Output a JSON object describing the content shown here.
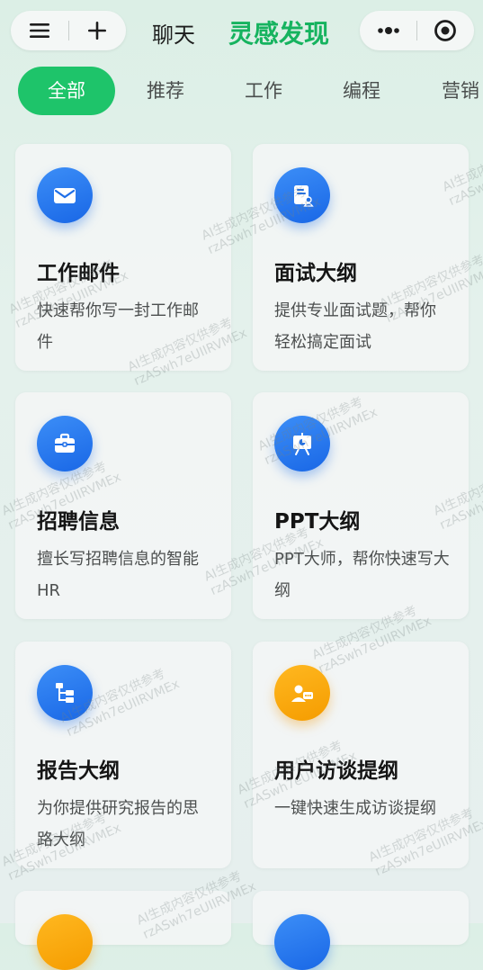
{
  "nav": {
    "chat_label": "聊天",
    "title": "灵感发现"
  },
  "categories": [
    {
      "label": "全部",
      "active": true
    },
    {
      "label": "推荐",
      "active": false
    },
    {
      "label": "工作",
      "active": false
    },
    {
      "label": "编程",
      "active": false
    },
    {
      "label": "营销",
      "active": false
    }
  ],
  "cards": [
    {
      "title": "工作邮件",
      "desc": "快速帮你写一封工作邮件",
      "icon": "mail-icon",
      "color": "#2a7cf0"
    },
    {
      "title": "面试大纲",
      "desc": "提供专业面试题，帮你轻松搞定面试",
      "icon": "resume-icon",
      "color": "#2a7cf0"
    },
    {
      "title": "招聘信息",
      "desc": "擅长写招聘信息的智能HR",
      "icon": "briefcase-icon",
      "color": "#2a7cf0"
    },
    {
      "title": "PPT大纲",
      "desc": "PPT大师，帮你快速写大纲",
      "icon": "presentation-icon",
      "color": "#2a7cf0"
    },
    {
      "title": "报告大纲",
      "desc": "为你提供研究报告的思路大纲",
      "icon": "outline-tree-icon",
      "color": "#2a7cf0"
    },
    {
      "title": "用户访谈提纲",
      "desc": "一键快速生成访谈提纲",
      "icon": "interview-icon",
      "color": "#f5a300"
    }
  ],
  "watermark": {
    "line1": "AI生成内容仅供参考",
    "line2": "rzASwh7eUIIRVMEx"
  },
  "colors": {
    "accent": "#1ec46a",
    "title_green": "#16b35f",
    "icon_blue": "#2a7cf0",
    "icon_orange": "#f5a300"
  }
}
